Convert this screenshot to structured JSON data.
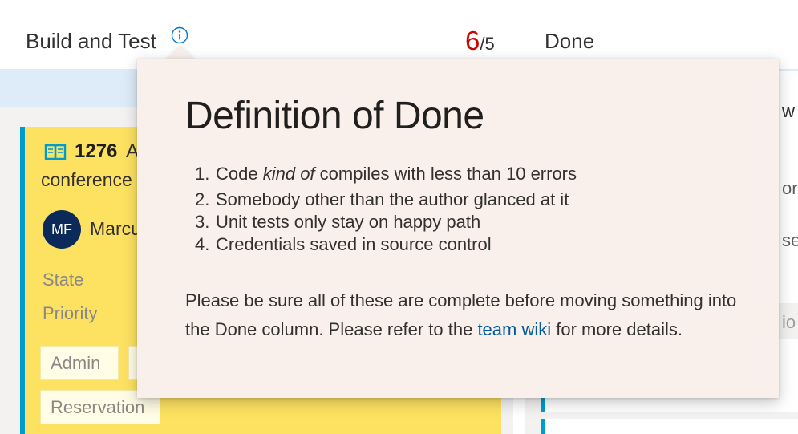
{
  "board": {
    "column1": {
      "title": "Build and Test",
      "wip_count": "6",
      "wip_limit": "/5"
    },
    "column2": {
      "title": "Done"
    }
  },
  "card": {
    "id": "1276",
    "title_line1": "As",
    "title_line2": "conference",
    "assignee_initials": "MF",
    "assignee_name": "Marcu",
    "fields": {
      "state_label": "State",
      "priority_label": "Priority"
    },
    "tags": [
      "Admin",
      "Reservation"
    ],
    "accent_color": "#009ccc",
    "card_color": "#fde261"
  },
  "right_column": {
    "fragments": [
      "w",
      "or",
      "se",
      "io"
    ]
  },
  "callout": {
    "title": "Definition of Done",
    "items": [
      {
        "number": "1.",
        "before": "Code ",
        "emphasis": "kind of",
        "after": " compiles with less than 10 errors"
      },
      {
        "number": "2.",
        "text": "Somebody other than the author glanced at it"
      },
      {
        "number": "3.",
        "text": "Unit tests only stay on happy path"
      },
      {
        "number": "4.",
        "text": "Credentials saved in source control"
      }
    ],
    "paragraph_before": "Please be sure all of these are complete before moving something into the Done column. Please refer to the ",
    "link_text": "team wiki",
    "paragraph_after": " for more details.",
    "background_color": "#faf0eb",
    "link_color": "#005a9e"
  },
  "icons": {
    "info": "info-icon",
    "work_item_type": "book-icon"
  },
  "colors": {
    "over_limit": "#d00000",
    "header_band": "#deecf9"
  }
}
